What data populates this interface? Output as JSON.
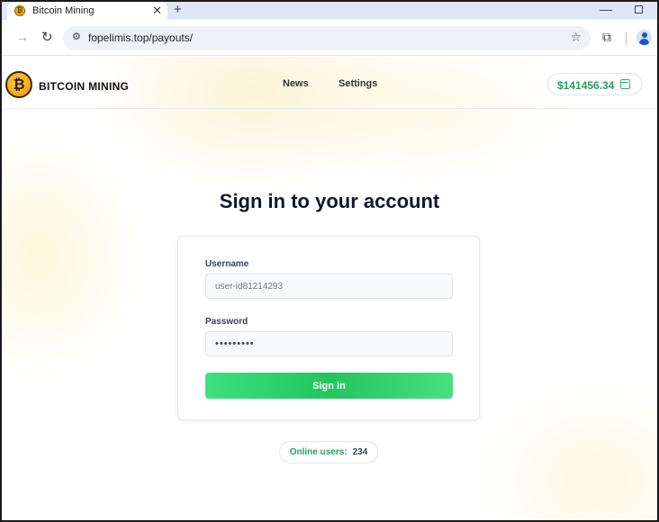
{
  "browser": {
    "tab_title": "Bitcoin Mining",
    "tab_close": "✕",
    "new_tab": "+",
    "url": "fopelimis.top/payouts/",
    "window_minimize": "—"
  },
  "site": {
    "brand_name": "BITCOIN MINING",
    "logo_glyph": "₿",
    "nav": [
      {
        "label": "News"
      },
      {
        "label": "Settings"
      }
    ],
    "balance": "$141456.34",
    "balance_icon": "wallet-icon"
  },
  "login": {
    "heading": "Sign in to your account",
    "username_label": "Username",
    "username_placeholder": "user-id81214293",
    "password_label": "Password",
    "password_value": "•••••••••",
    "submit_label": "Sign in"
  },
  "status": {
    "online_label": "Online users:",
    "online_count": "234"
  },
  "colors": {
    "accent_green": "#22c55e",
    "balance_green": "#2f9a5e"
  }
}
